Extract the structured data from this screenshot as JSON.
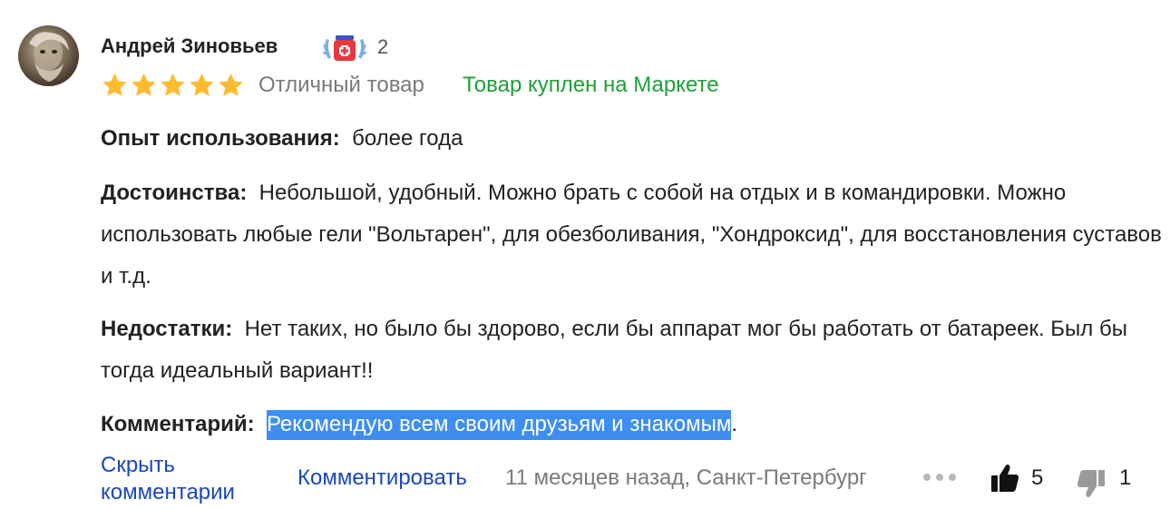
{
  "review": {
    "author": "Андрей Зиновьев",
    "badge_count": "2",
    "rating": 5,
    "rating_text": "Отличный товар",
    "purchase_note": "Товар куплен на Маркете",
    "experience_label": "Опыт использования:",
    "experience_value": "более года",
    "pros_label": "Достоинства:",
    "pros_value": "Небольшой, удобный. Можно брать с собой на отдых и в командировки. Можно использовать любые гели \"Вольтарен\", для обезболивания, \"Хондроксид\", для восстановления суставов и т.д.",
    "cons_label": "Недостатки:",
    "cons_value": "Нет таких, но было бы здорово, если бы аппарат мог бы работать от батареек. Был бы тогда идеальный вариант!!",
    "comment_label": "Комментарий:",
    "comment_value": "Рекомендую всем своим друзьям и знакомым",
    "comment_tail": "."
  },
  "footer": {
    "hide_comments": "Скрыть комментарии",
    "comment_action": "Комментировать",
    "meta": "11 месяцев назад, Санкт-Петербург",
    "likes": "5",
    "dislikes": "1"
  },
  "colors": {
    "star": "#fdbb2d",
    "green": "#21a038",
    "link": "#1a47b8",
    "highlight": "#3d8ef0"
  },
  "icons": [
    "more-dots-icon",
    "thumbs-up-icon",
    "thumbs-down-icon",
    "achievement-badge-icon"
  ]
}
